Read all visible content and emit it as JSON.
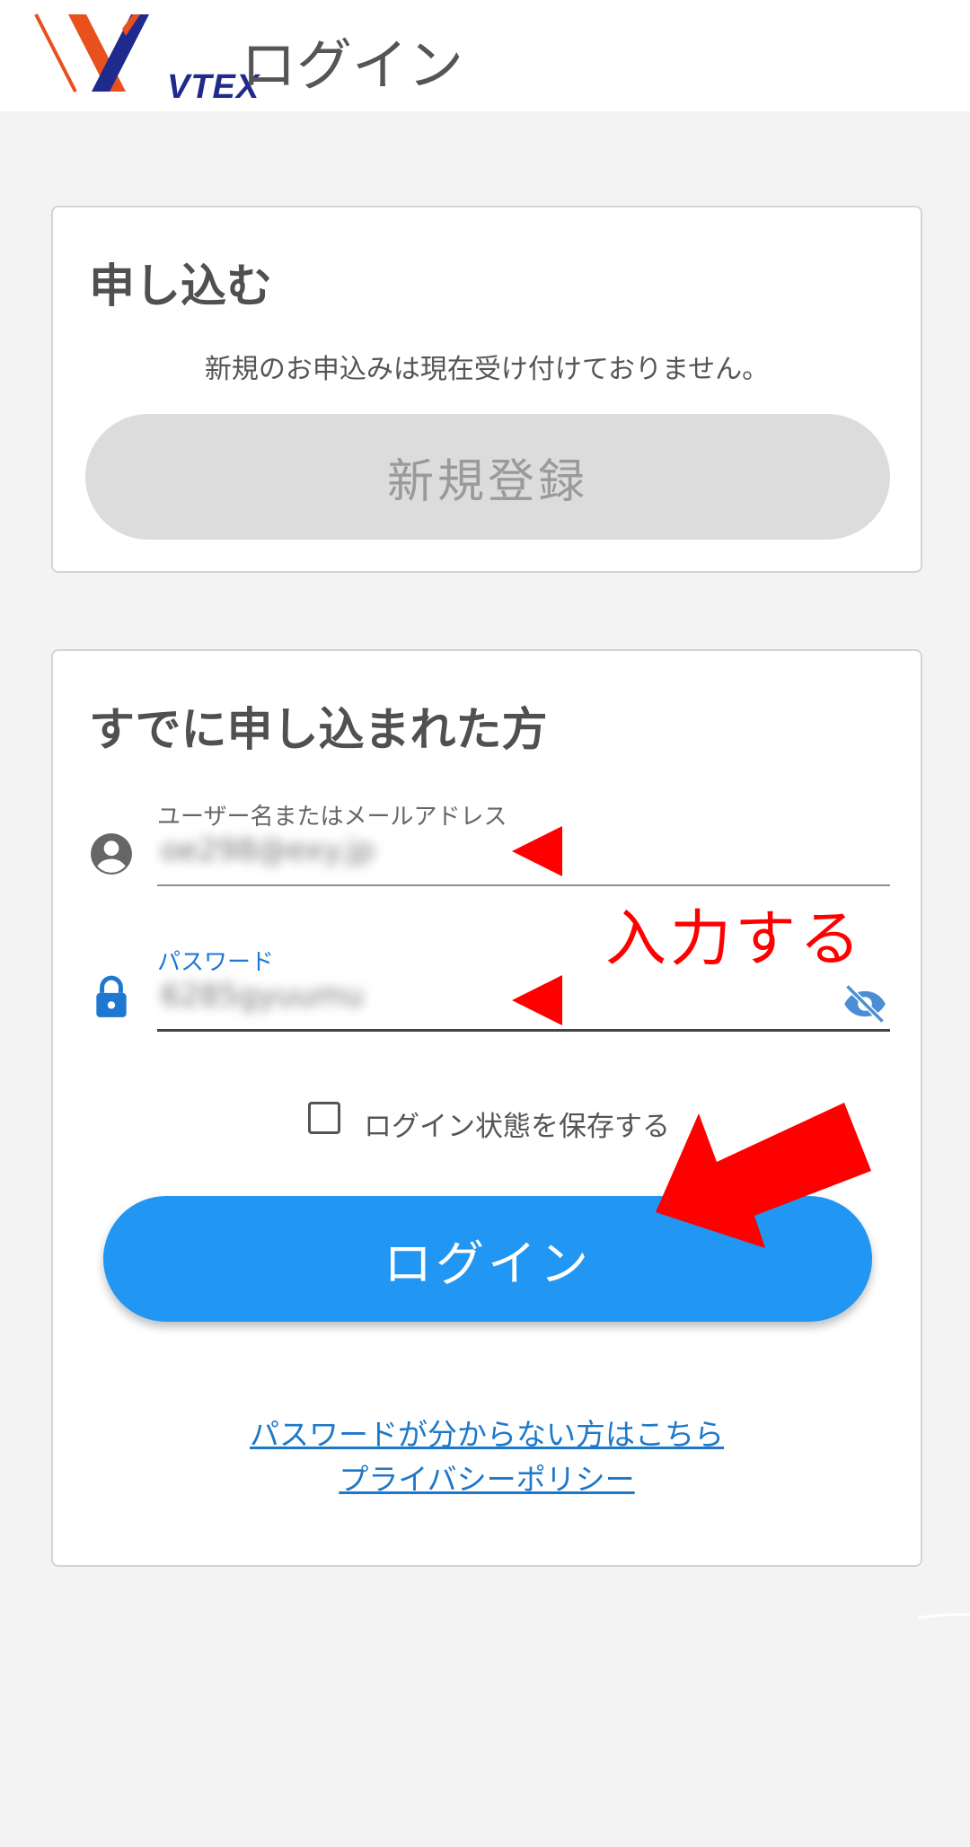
{
  "header": {
    "logo_text": "VTEX",
    "title": "ログイン"
  },
  "register_card": {
    "title": "申し込む",
    "notice": "新規のお申込みは現在受け付けておりません。",
    "register_button": "新規登録"
  },
  "login_card": {
    "title": "すでに申し込まれた方",
    "username_label": "ユーザー名またはメールアドレス",
    "username_value": "oe298@exy.jp",
    "password_label": "パスワード",
    "password_value": "6285gyuumu",
    "remember_label": "ログイン状態を保存する",
    "remember_checked": false,
    "login_button": "ログイン",
    "forgot_link": "パスワードが分からない方はこちら",
    "privacy_link": "プライバシーポリシー"
  },
  "annotation": {
    "text": "入力する",
    "color": "#ff0000"
  },
  "colors": {
    "primary": "#2196f3",
    "link": "#1e78c8",
    "logo_orange": "#e8501e",
    "logo_navy": "#1f2a8c"
  },
  "icons": {
    "username": "account-circle-icon",
    "password": "lock-icon",
    "visibility": "eye-off-icon"
  }
}
